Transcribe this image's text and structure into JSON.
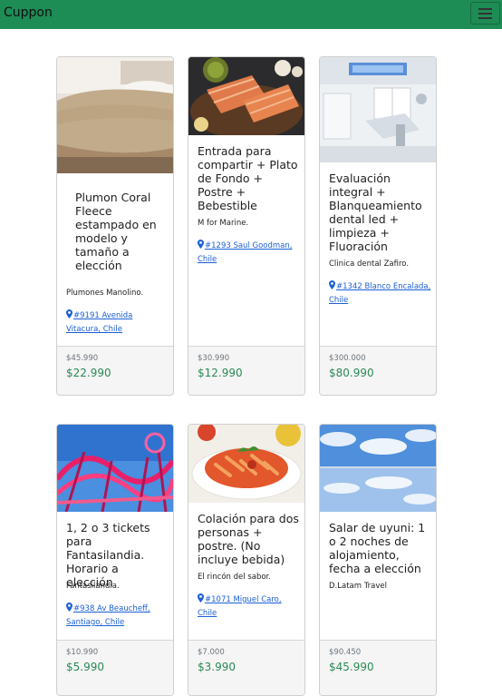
{
  "navbar": {
    "brand": "Cuppon",
    "menu_icon": "hamburger-icon"
  },
  "colors": {
    "navbar": "#1e8c55",
    "price": "#2a8a55",
    "link": "#1a5fd6"
  },
  "cards": [
    {
      "image": "blanket-bed-photo",
      "title": "Plumon Coral Fleece estampado en modelo y tamaño a elección",
      "merchant": "Plumones Manolino.",
      "location": "#9191 Avenida Vitacura, Chile",
      "old_price": "$45.990",
      "price": "$22.990"
    },
    {
      "image": "salmon-dish-photo",
      "title": "Entrada para compartir + Plato de Fondo + Postre + Bebestible",
      "merchant": "M for Marine.",
      "location": "#1293 Saul Goodman, Chile",
      "old_price": "$30.990",
      "price": "$12.990"
    },
    {
      "image": "dental-clinic-photo",
      "title": "Evaluación integral + Blanqueamiento dental led + limpieza + Fluoración",
      "merchant": "Clinica dental Zafiro.",
      "location": "#1342 Blanco Encalada, Chile",
      "old_price": "$300.000",
      "price": "$80.990"
    },
    {
      "image": "amusement-park-photo",
      "title": "1, 2 o 3 tickets para Fantasilandia. Horario a elección",
      "merchant": "Fantasilandia.",
      "location": "#938 Av Beaucheff, Santiago, Chile",
      "old_price": "$10.990",
      "price": "$5.990"
    },
    {
      "image": "pasta-dish-photo",
      "title": "Colación para dos personas + postre. (No incluye bebida)",
      "merchant": "El rincón del sabor.",
      "location": "#1071 Miguel Caro, Chile",
      "old_price": "$7.000",
      "price": "$3.990"
    },
    {
      "image": "salt-flat-photo",
      "title": "Salar de uyuni: 1 o 2 noches de alojamiento, fecha a elección",
      "merchant": "D.Latam Travel",
      "location": "",
      "old_price": "$90.450",
      "price": "$45.990"
    }
  ]
}
